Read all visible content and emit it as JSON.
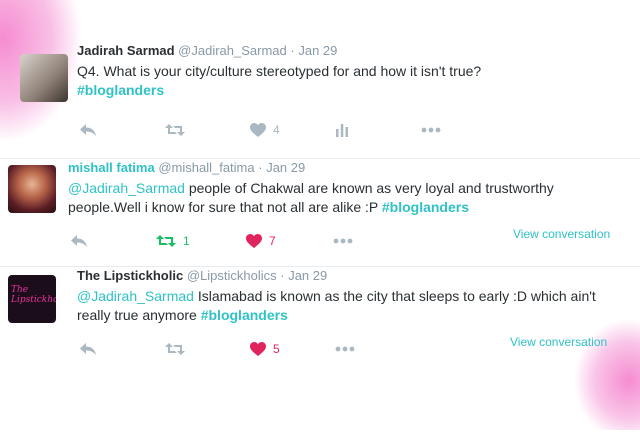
{
  "tweets": [
    {
      "name": "Jadirah Sarmad",
      "handle": "@Jadirah_Sarmad",
      "separator": "·",
      "date": "Jan 29",
      "text": "Q4. What is your city/culture stereotyped for and how it isn't true?",
      "hashtag": "#bloglanders",
      "likes": "4"
    },
    {
      "name": "mishall fatima",
      "handle": "@mishall_fatima",
      "separator": "·",
      "date": "Jan 29",
      "mention": "@Jadirah_Sarmad",
      "text": " people of Chakwal are known as very loyal and trustworthy people.Well i know for sure that not all are alike :P ",
      "hashtag": "#bloglanders",
      "retweets": "1",
      "likes": "7",
      "view_conversation": "View conversation"
    },
    {
      "name": "The Lipstickholic",
      "handle": "@Lipstickholics",
      "separator": "·",
      "date": "Jan 29",
      "mention": "@Jadirah_Sarmad",
      "text": " Islamabad is known as the city that sleeps to early :D which ain't really true anymore ",
      "hashtag": "#bloglanders",
      "likes": "5",
      "view_conversation": "View conversation",
      "avatar_logo": "The Lipstickholic"
    }
  ],
  "colors": {
    "accent": "#2fc2c6",
    "retweet_active": "#17bf63",
    "like_active": "#e0245e",
    "icon_gray": "#aab8c2"
  },
  "icons": {
    "reply": "reply-icon",
    "retweet": "retweet-icon",
    "like": "heart-icon",
    "analytics": "analytics-icon",
    "more": "more-icon"
  }
}
